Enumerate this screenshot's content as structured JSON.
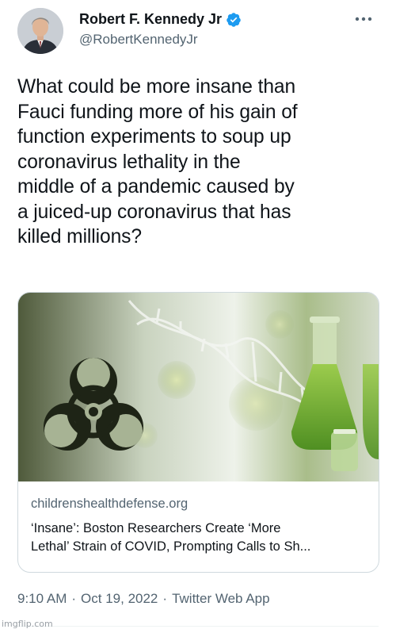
{
  "author": {
    "display_name": "Robert F. Kennedy Jr",
    "handle": "@RobertKennedyJr",
    "verified": true,
    "avatar_icon": "profile-photo"
  },
  "more_icon": "more-horizontal-icon",
  "tweet": {
    "text": "What could be more insane than\nFauci funding more of his gain of\nfunction experiments to soup up\ncoronavirus lethality in the\nmiddle of a pandemic caused by\na juiced-up coronavirus that has\nkilled millions?"
  },
  "link_card": {
    "domain": "childrenshealthdefense.org",
    "title": "‘Insane’: Boston Researchers Create ‘More\nLethal’ Strain of COVID, Prompting Calls to Sh...",
    "image_icons": [
      "biohazard-icon",
      "dna-helix-icon",
      "lab-flask-icon"
    ]
  },
  "meta": {
    "time": "9:10 AM",
    "date": "Oct 19, 2022",
    "separator": "·",
    "source": "Twitter Web App"
  },
  "watermark": "imgflip.com",
  "colors": {
    "text": "#0f1419",
    "secondary": "#536471",
    "verified_blue": "#1d9bf0",
    "border": "#cfd9de"
  }
}
